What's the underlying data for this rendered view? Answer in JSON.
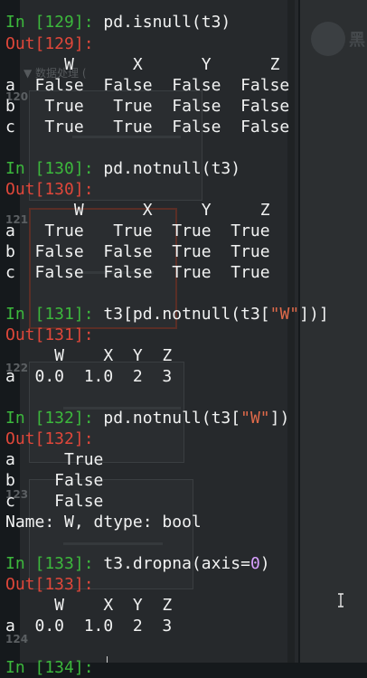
{
  "colors": {
    "prompt_in": "#3cb83c",
    "prompt_out": "#e0473a",
    "text": "#f1f2f2",
    "number_literal": "#d8a0ff",
    "string_literal": "#e06a4a",
    "background": "#15191c"
  },
  "cells": [
    {
      "in_prompt": "In [129]:",
      "code_before": "pd.isnull(t3)",
      "out_prompt": "Out[129]:",
      "output": [
        "      W      X      Y      Z",
        "a  False  False  False  False",
        "b   True   True  False  False",
        "c   True   True  False  False"
      ]
    },
    {
      "in_prompt": "In [130]:",
      "code_before": "pd.notnull(t3)",
      "out_prompt": "Out[130]:",
      "output": [
        "       W      X     Y     Z",
        "a   True   True  True  True",
        "b  False  False  True  True",
        "c  False  False  True  True"
      ]
    },
    {
      "in_prompt": "In [131]:",
      "code_before": "t3[pd.notnull(t3[",
      "code_string": "\"W\"",
      "code_after": "])]",
      "out_prompt": "Out[131]:",
      "output": [
        "     W    X  Y  Z",
        "a  0.0  1.0  2  3"
      ]
    },
    {
      "in_prompt": "In [132]:",
      "code_before": "pd.notnull(t3[",
      "code_string": "\"W\"",
      "code_after": "])",
      "out_prompt": "Out[132]:",
      "output": [
        "a     True",
        "b    False",
        "c    False",
        "Name: W, dtype: bool"
      ]
    },
    {
      "in_prompt": "In [133]:",
      "code_before": "t3.dropna(axis=",
      "code_number": "0",
      "code_after": ")",
      "out_prompt": "Out[133]:",
      "output": [
        "     W    X  Y  Z",
        "a  0.0  1.0  2  3"
      ]
    }
  ],
  "next_prompt": "In [134]:",
  "bg_doc": {
    "logo_text": "黑",
    "heading": "▼ 数据处理 (",
    "slide_numbers": [
      "120",
      "121",
      "122",
      "123",
      "124"
    ]
  },
  "icons": {
    "cursor": "ibeam-cursor-icon"
  }
}
